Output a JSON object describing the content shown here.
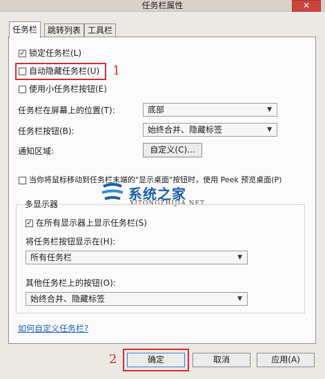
{
  "window": {
    "title": "任务栏属性",
    "close_glyph": "✕"
  },
  "tabs": [
    {
      "label": "任务栏",
      "active": true
    },
    {
      "label": "跳转列表",
      "active": false
    },
    {
      "label": "工具栏",
      "active": false
    }
  ],
  "taskbar": {
    "lock": {
      "label": "锁定任务栏(L)",
      "checked": true
    },
    "autohide": {
      "label": "自动隐藏任务栏(U)",
      "checked": false
    },
    "small_buttons": {
      "label": "使用小任务栏按钮(E)",
      "checked": false
    },
    "location": {
      "label": "任务栏在屏幕上的位置(T):",
      "value": "底部"
    },
    "buttons": {
      "label": "任务栏按钮(B):",
      "value": "始终合并、隐藏标签"
    },
    "notify": {
      "label": "通知区域:",
      "button": "自定义(C)..."
    },
    "peek": {
      "label": "当你将鼠标移动到任务栏末端的\"显示桌面\"按钮时，使用 Peek 预览桌面(P)",
      "checked": false
    }
  },
  "multi_display": {
    "title": "多显示器",
    "show_all": {
      "label": "在所有显示器上显示任务栏(S)",
      "checked": true
    },
    "show_buttons_on": {
      "label": "将任务栏按钮显示在(H):",
      "value": "所有任务栏"
    },
    "other_buttons": {
      "label": "其他任务栏上的按钮(O):",
      "value": "始终合并、隐藏标签"
    }
  },
  "link": "如何自定义任务栏?",
  "footer": {
    "ok": "确定",
    "cancel": "取消",
    "apply": "应用(A)"
  },
  "annotations": {
    "one": "1",
    "two": "2"
  },
  "watermark": {
    "text": "系统之家",
    "sub": "XITONGZHIJIA.NET"
  },
  "colors": {
    "annotation_red": "#d8292f",
    "link_blue": "#1f5fb8",
    "watermark_blue": "#1b5fa8"
  }
}
